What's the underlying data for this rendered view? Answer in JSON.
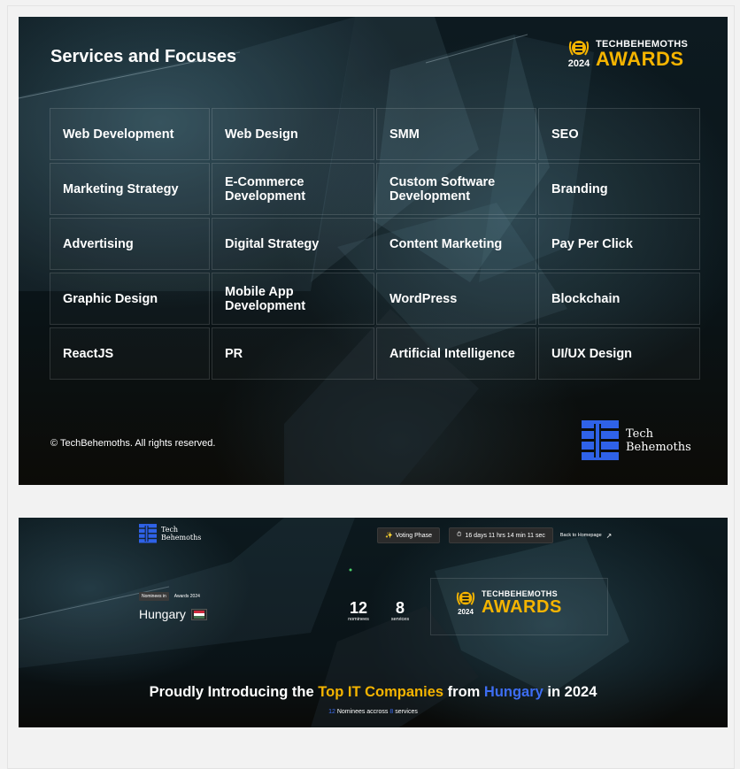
{
  "card1": {
    "title": "Services and Focuses",
    "awards_badge": {
      "brand": "TECHBEHEMOTHS",
      "awards": "AWARDS",
      "year": "2024"
    },
    "services": [
      "Web Development",
      "Web Design",
      "SMM",
      "SEO",
      "Marketing Strategy",
      "E-Commerce Development",
      "Custom Software Development",
      "Branding",
      "Advertising",
      "Digital Strategy",
      "Content Marketing",
      "Pay Per Click",
      "Graphic Design",
      "Mobile App Development",
      "WordPress",
      "Blockchain",
      "ReactJS",
      "PR",
      "Artificial Intelligence",
      "UI/UX Design"
    ],
    "footer": "© TechBehemoths. All rights reserved.",
    "logo_text": {
      "line1": "Tech",
      "line2": "Behemoths"
    }
  },
  "card2": {
    "logo_text": {
      "line1": "Tech",
      "line2": "Behemoths"
    },
    "voting_phase": "Voting Phase",
    "countdown": "16 days 11 hrs 14 min 11 sec",
    "back_link": "Back to Homepage",
    "tag_nominees_in": "Nominees in",
    "tag_awards": "Awards 2024",
    "country": "Hungary",
    "nominees_count": "12",
    "nominees_label": "nominees",
    "services_count": "8",
    "services_label": "services",
    "awards_badge": {
      "brand": "TECHBEHEMOTHS",
      "awards": "AWARDS",
      "year": "2024"
    },
    "headline": {
      "part1": "Proudly Introducing the ",
      "highlight1": "Top IT Companies",
      "part2": " from ",
      "highlight2": "Hungary",
      "part3": " in 2024"
    },
    "subline": {
      "n1": "12",
      "t1": " Nominees accross ",
      "n2": "8",
      "t2": " services"
    }
  },
  "colors": {
    "accent_gold": "#f5b400",
    "accent_blue": "#3d6df2",
    "background_dark": "#0b1519"
  },
  "icons": {
    "sparkle": "sparkle-icon",
    "stopwatch": "stopwatch-icon",
    "arrow": "arrow-up-right-icon",
    "laurel": "laurel-logo-icon",
    "flag": "hungary-flag-icon"
  }
}
